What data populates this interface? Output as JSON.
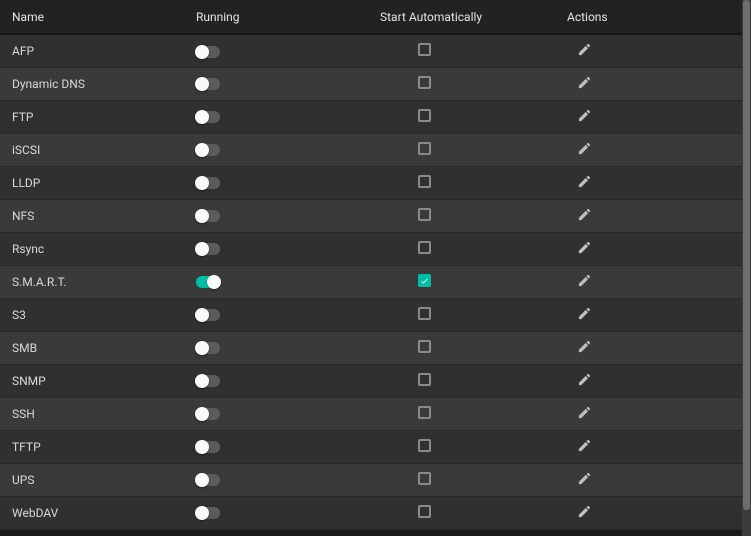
{
  "columns": {
    "name": "Name",
    "running": "Running",
    "autostart": "Start Automatically",
    "actions": "Actions"
  },
  "services": [
    {
      "name": "AFP",
      "running": false,
      "autostart": false
    },
    {
      "name": "Dynamic DNS",
      "running": false,
      "autostart": false
    },
    {
      "name": "FTP",
      "running": false,
      "autostart": false
    },
    {
      "name": "iSCSI",
      "running": false,
      "autostart": false
    },
    {
      "name": "LLDP",
      "running": false,
      "autostart": false
    },
    {
      "name": "NFS",
      "running": false,
      "autostart": false
    },
    {
      "name": "Rsync",
      "running": false,
      "autostart": false
    },
    {
      "name": "S.M.A.R.T.",
      "running": true,
      "autostart": true
    },
    {
      "name": "S3",
      "running": false,
      "autostart": false
    },
    {
      "name": "SMB",
      "running": false,
      "autostart": false
    },
    {
      "name": "SNMP",
      "running": false,
      "autostart": false
    },
    {
      "name": "SSH",
      "running": false,
      "autostart": false
    },
    {
      "name": "TFTP",
      "running": false,
      "autostart": false
    },
    {
      "name": "UPS",
      "running": false,
      "autostart": false
    },
    {
      "name": "WebDAV",
      "running": false,
      "autostart": false
    }
  ]
}
